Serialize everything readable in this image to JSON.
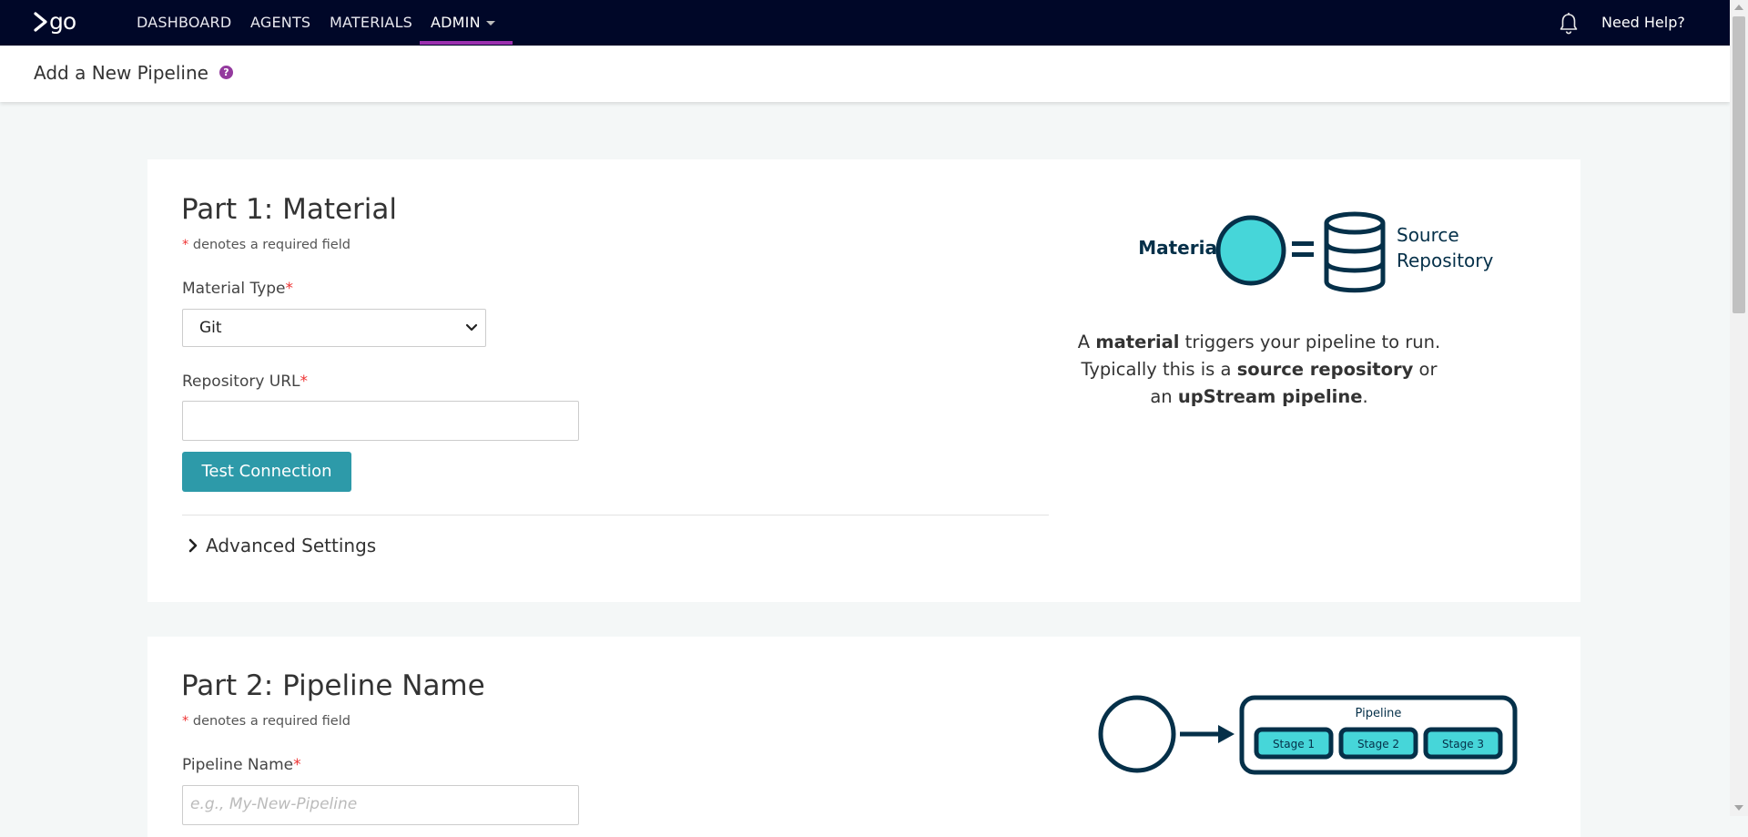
{
  "nav": {
    "logo_text": "go",
    "items": [
      {
        "label": "DASHBOARD"
      },
      {
        "label": "AGENTS"
      },
      {
        "label": "MATERIALS"
      },
      {
        "label": "ADMIN"
      }
    ],
    "need_help": "Need Help?"
  },
  "header": {
    "title": "Add a New Pipeline",
    "help_glyph": "?"
  },
  "part1": {
    "title": "Part 1: Material",
    "required_star": "*",
    "required_note": " denotes a required field",
    "material_type_label": "Material Type",
    "material_type_value": "Git",
    "repo_url_label": "Repository URL",
    "repo_url_value": "",
    "test_button": "Test Connection",
    "advanced_settings": "Advanced Settings",
    "illustration": {
      "material": "Material",
      "source": "Source",
      "repository": "Repository"
    },
    "description": {
      "l1_a": "A ",
      "l1_b": "material",
      "l1_c": " triggers your pipeline to run.",
      "l2_a": "Typically this is a ",
      "l2_b": "source repository",
      "l2_c": " or",
      "l3_a": "an ",
      "l3_b": "upStream pipeline",
      "l3_c": "."
    }
  },
  "part2": {
    "title": "Part 2: Pipeline Name",
    "required_star": "*",
    "required_note": " denotes a required field",
    "pipeline_name_label": "Pipeline Name",
    "pipeline_name_placeholder": "e.g., My-New-Pipeline",
    "illustration": {
      "pipeline": "Pipeline",
      "stages": [
        "Stage 1",
        "Stage 2",
        "Stage 3"
      ]
    }
  },
  "colors": {
    "nav_bg": "#000728",
    "accent_purple": "#9b2fae",
    "teal_button": "#2d9aa9",
    "illus_dark": "#053049",
    "illus_cyan": "#46d6d9"
  }
}
